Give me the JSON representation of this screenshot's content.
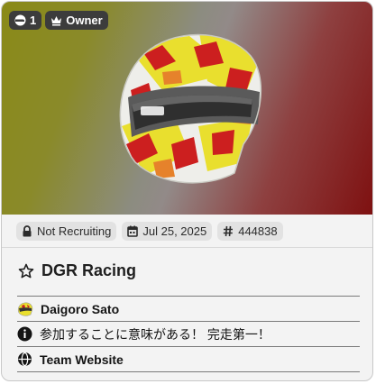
{
  "header": {
    "member_count": "1",
    "role": "Owner"
  },
  "meta": {
    "recruiting": "Not Recruiting",
    "date": "Jul 25, 2025",
    "team_id": "444838"
  },
  "team": {
    "name": "DGR Racing"
  },
  "info": {
    "owner_name": "Daigoro Sato",
    "description": "参加することに意味がある！ 完走第一！",
    "website_label": "Team Website"
  },
  "icons": {
    "member": "driver-icon",
    "owner": "crown-icon",
    "lock": "lock-icon",
    "calendar": "calendar-icon",
    "hash": "hash-icon",
    "star": "star-icon",
    "avatar": "helmet-avatar",
    "info": "info-icon",
    "globe": "globe-icon"
  },
  "colors": {
    "badge_bg": "#3c3c3c",
    "chip_bg": "#e2e2e2",
    "helmet_yellow": "#e9df2e",
    "helmet_red": "#cc1f1f"
  }
}
